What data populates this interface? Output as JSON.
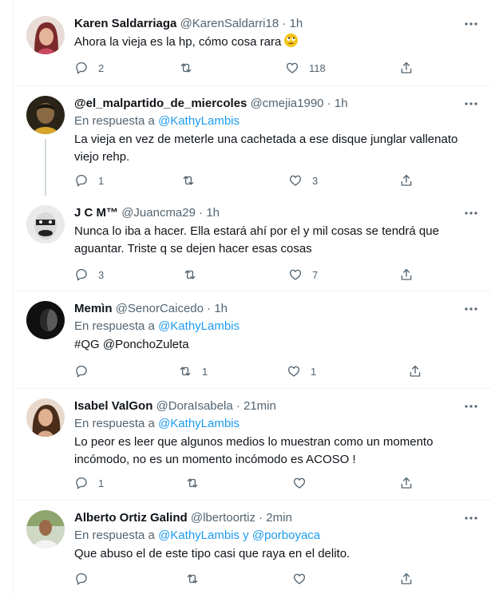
{
  "tweets": [
    {
      "name": "Karen Saldarriaga",
      "handle": "@KarenSaldarri18",
      "sep": "·",
      "time": "1h",
      "reply_prefix": "",
      "reply_to": "",
      "text": "Ahora la vieja es la hp, cómo cosa rara",
      "emoji": "face-with-rolling-eyes",
      "replies": "2",
      "retweets": "",
      "likes": "118"
    },
    {
      "name": "@el_malpartido_de_miercoles",
      "handle": "@cmejia1990",
      "sep": "·",
      "time": "1h",
      "reply_prefix": "En respuesta a",
      "reply_to": "@KathyLambis",
      "text": "La vieja en vez de meterle una cachetada a ese disque junglar vallenato viejo rehp.",
      "replies": "1",
      "retweets": "",
      "likes": "3"
    },
    {
      "name": "J C M™",
      "handle": "@Juancma29",
      "sep": "·",
      "time": "1h",
      "reply_prefix": "",
      "reply_to": "",
      "text": "Nunca lo iba a hacer. Ella estará ahí por el y mil cosas se tendrá que aguantar. Triste q se dejen hacer esas cosas",
      "replies": "3",
      "retweets": "",
      "likes": "7"
    },
    {
      "name": "Memìn",
      "handle": "@SenorCaicedo",
      "sep": "·",
      "time": "1h",
      "reply_prefix": "En respuesta a",
      "reply_to": "@KathyLambis",
      "text_links": "#QG @PonchoZuleta",
      "replies": "",
      "retweets": "1",
      "likes": "1"
    },
    {
      "name": "Isabel ValGon",
      "handle": "@DoraIsabela",
      "sep": "·",
      "time": "21min",
      "reply_prefix": "En respuesta a",
      "reply_to": "@KathyLambis",
      "text": "Lo peor es leer que algunos medios lo muestran como un momento incómodo, no es un momento incómodo es ACOSO !",
      "replies": "1",
      "retweets": "",
      "likes": ""
    },
    {
      "name": "Alberto Ortiz Galind",
      "handle": "@lbertoortiz",
      "sep": "·",
      "time": "2min",
      "reply_prefix": "En respuesta a",
      "reply_to": "@KathyLambis y @porboyaca",
      "text": "Que abuso el de este tipo casi que raya en el delito.",
      "replies": "",
      "retweets": "",
      "likes": ""
    }
  ],
  "colors": {
    "link": "#1d9bf0",
    "secondary_text": "#536471",
    "primary_text": "#0f1419",
    "divider": "#eff3f4",
    "thread_line": "#cfd9de"
  },
  "icons": [
    "reply-icon",
    "retweet-icon",
    "like-icon",
    "share-icon",
    "more-icon"
  ]
}
